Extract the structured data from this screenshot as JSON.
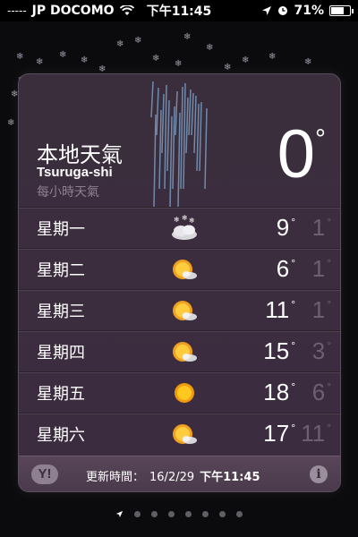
{
  "status_bar": {
    "signal": "-----",
    "carrier": "JP DOCOMO",
    "time": "下午11:45",
    "battery_percent": "71%",
    "battery_level": 0.71
  },
  "weather": {
    "location_title": "本地天氣",
    "city": "Tsuruga-shi",
    "hourly_label": "每小時天氣",
    "current_temp": "0",
    "degree_symbol": "°",
    "forecast": [
      {
        "day": "星期一",
        "high": "9",
        "low": "1",
        "icon": "snow-cloud-icon"
      },
      {
        "day": "星期二",
        "high": "6",
        "low": "1",
        "icon": "partly-cloudy-icon"
      },
      {
        "day": "星期三",
        "high": "11",
        "low": "1",
        "icon": "partly-cloudy-icon"
      },
      {
        "day": "星期四",
        "high": "15",
        "low": "3",
        "icon": "partly-cloudy-icon"
      },
      {
        "day": "星期五",
        "high": "18",
        "low": "6",
        "icon": "sun-icon"
      },
      {
        "day": "星期六",
        "high": "17",
        "low": "11",
        "icon": "partly-cloudy-icon"
      }
    ],
    "footer": {
      "yahoo_label": "Y!",
      "updated_label": "更新時間：",
      "updated_date": "16/2/29",
      "updated_time": "下午11:45",
      "info_label": "i"
    }
  },
  "pager": {
    "page_count": 7
  },
  "colors": {
    "card_bg": "#3b2d3e",
    "low_temp": "#6e6071",
    "hourly_text": "#8d7f90"
  }
}
